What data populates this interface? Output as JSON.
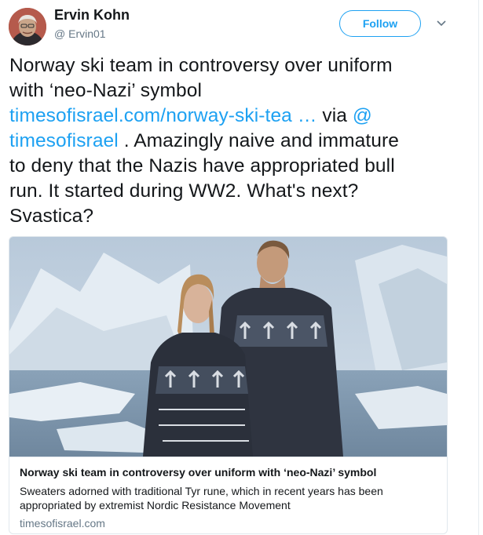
{
  "user": {
    "name": "Ervin Kohn",
    "handle": "@ Ervin01"
  },
  "actions": {
    "follow_label": "Follow"
  },
  "icons": {
    "more": "chevron-down-icon"
  },
  "tweet": {
    "line1": "Norway ski team in controversy over uniform",
    "line2": "with ‘neo-Nazi’ symbol",
    "link_url": "timesofisrael.com/norway-ski-tea",
    "ellipsis": " … ",
    "via": "via ",
    "mention_at": "@",
    "mention_name": "timesofisrael",
    "rest1": " . Amazingly naive and immature",
    "line5": "to deny that the Nazis have appropriated bull",
    "line6": "run. It started during WW2. What's next?",
    "line7": "Svastica?"
  },
  "card": {
    "title": "Norway ski team in controversy over uniform with ‘neo-Nazi’ symbol",
    "description": "Sweaters adorned with traditional Tyr rune, which in recent years has been appropriated by extremist Nordic Resistance Movement",
    "domain": "timesofisrael.com"
  },
  "colors": {
    "accent": "#1da1f2",
    "text": "#14171a",
    "secondary": "#657786",
    "border": "#e1e8ed"
  }
}
